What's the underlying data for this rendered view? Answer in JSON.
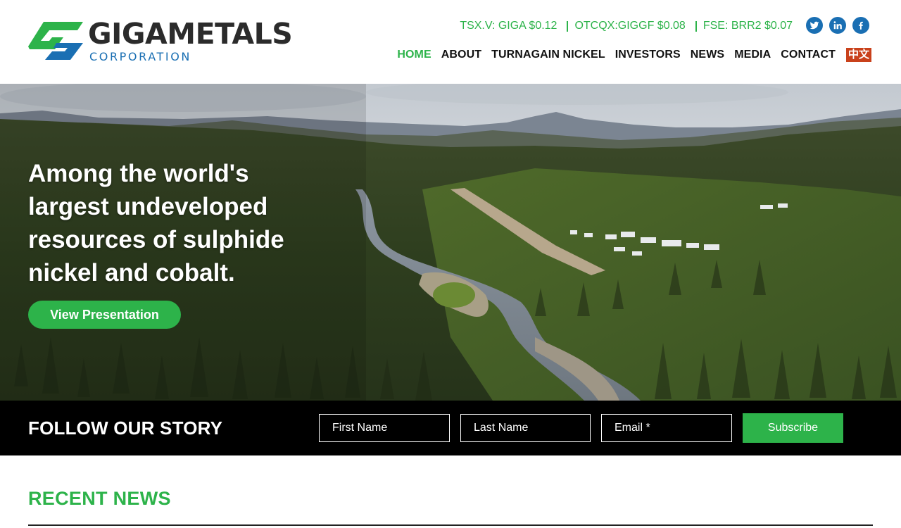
{
  "brand": {
    "name": "GIGAMETALS",
    "subtitle": "CORPORATION",
    "colors": {
      "green": "#2db34a",
      "blue": "#1a6fb3",
      "dark": "#2b2b2b",
      "lang_badge": "#c9411b"
    }
  },
  "tickers": [
    "TSX.V: GIGA $0.12",
    "OTCQX:GIGGF $0.08",
    "FSE: BRR2 $0.07"
  ],
  "social": [
    {
      "icon": "twitter-icon"
    },
    {
      "icon": "linkedin-icon"
    },
    {
      "icon": "facebook-icon"
    }
  ],
  "nav": {
    "items": [
      {
        "label": "HOME",
        "active": true
      },
      {
        "label": "ABOUT",
        "active": false
      },
      {
        "label": "TURNAGAIN NICKEL",
        "active": false
      },
      {
        "label": "INVESTORS",
        "active": false
      },
      {
        "label": "NEWS",
        "active": false
      },
      {
        "label": "MEDIA",
        "active": false
      },
      {
        "label": "CONTACT",
        "active": false
      }
    ],
    "language": "中文"
  },
  "hero": {
    "title": "Among the world's largest undeveloped resources of sulphide nickel and cobalt.",
    "button_label": "View Presentation"
  },
  "follow": {
    "title": "FOLLOW OUR STORY",
    "first_name_placeholder": "First Name",
    "last_name_placeholder": "Last Name",
    "email_placeholder": "Email *",
    "subscribe_label": "Subscribe"
  },
  "news": {
    "title": "RECENT NEWS"
  }
}
